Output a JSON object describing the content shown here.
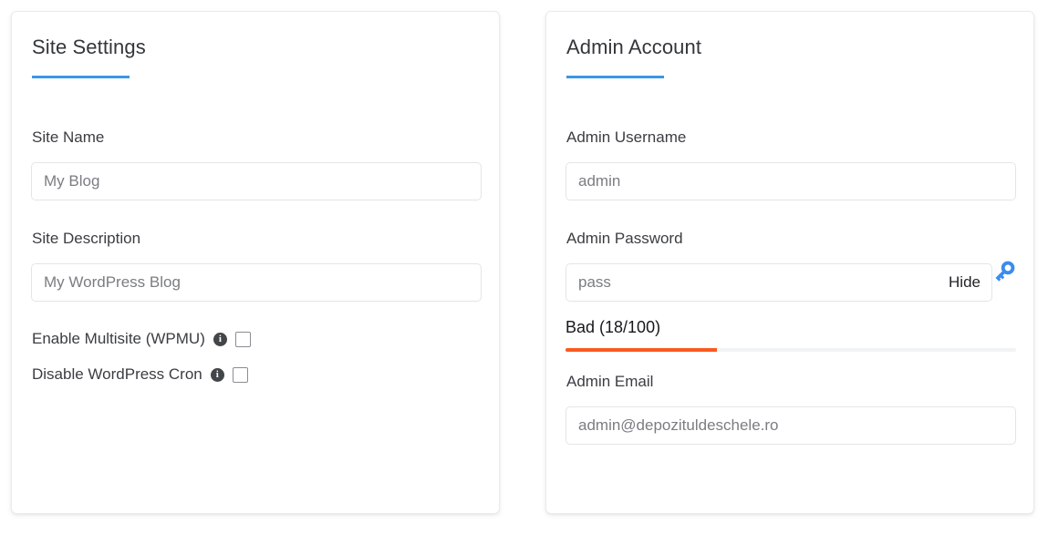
{
  "site_settings": {
    "title": "Site Settings",
    "accent_color": "#3b97e3",
    "fields": [
      {
        "label": "Site Name",
        "value": "My Blog"
      },
      {
        "label": "Site Description",
        "value": "My WordPress Blog"
      }
    ],
    "checkboxes": [
      {
        "label": "Enable Multisite (WPMU)",
        "info_glyph": "i",
        "checked": false
      },
      {
        "label": "Disable WordPress Cron",
        "info_glyph": "i",
        "checked": false
      }
    ]
  },
  "admin_account": {
    "title": "Admin Account",
    "accent_color": "#3b97e3",
    "username": {
      "label": "Admin Username",
      "value": "admin"
    },
    "password": {
      "label": "Admin Password",
      "value": "pass",
      "toggle_label": "Hide",
      "generate_icon": "key-icon",
      "generate_icon_color": "#3b8bf0",
      "strength_text": "Bad (18/100)",
      "strength_score": 18,
      "strength_max": 100,
      "strength_color": "#fa5a1e"
    },
    "email": {
      "label": "Admin Email",
      "value": "admin@depozituldeschele.ro"
    }
  }
}
